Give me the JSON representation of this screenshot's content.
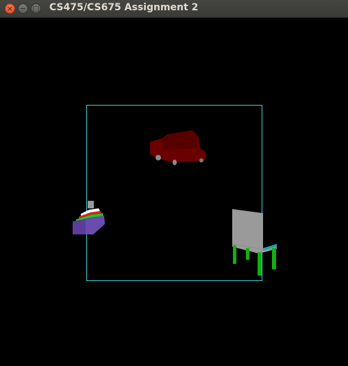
{
  "window": {
    "title": "CS475/CS675 Assignment 2",
    "close_glyph": "×",
    "minimize_glyph": "−",
    "maximize_glyph": "□"
  },
  "scene": {
    "background_color": "#000000",
    "frame_color": "#3fd6d6",
    "objects": [
      {
        "name": "car",
        "body_color": "#6b0000",
        "wheel_color": "#8c8c8c"
      },
      {
        "name": "boat",
        "hull_color": "#5a3c9a",
        "stripe_colors": [
          "#22c322",
          "#e01b1b",
          "#ffffff"
        ],
        "mast_color": "#9a9a9a"
      },
      {
        "name": "chair",
        "seat_color": "#9a9a9a",
        "leg_color": "#10b010",
        "trim_color": "#21a5a5"
      }
    ]
  }
}
